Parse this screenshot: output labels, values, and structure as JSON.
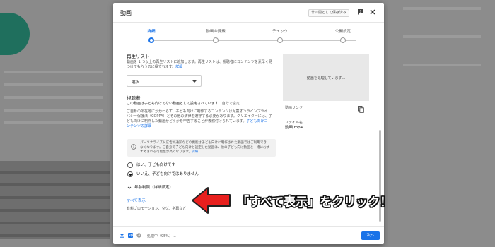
{
  "dialog": {
    "title": "動画",
    "save_private_label": "非公開として保存済み"
  },
  "stepper": {
    "steps": [
      {
        "label": "詳細",
        "active": true
      },
      {
        "label": "動画の要素",
        "active": false
      },
      {
        "label": "チェック",
        "active": false
      },
      {
        "label": "公開設定",
        "active": false
      }
    ]
  },
  "playlist": {
    "heading": "再生リスト",
    "description_line1": "動画を 1 つ以上の再生リストに追加します。再生リストは、視聴者にコンテンツを素早く見",
    "description_line2": "つけてもらうのに役立ちます。",
    "details_link": "詳細",
    "select_value": "選択"
  },
  "audience": {
    "heading": "視聴者",
    "status": "この動画は子ども向けでない動画として設定されています",
    "status_suffix": "自分で設定",
    "body_line1": "ご自身の所在地にかかわらず、子ども向けに制作するコンテンツは児童オンラインプライ",
    "body_line2": "バシー保護法（COPPA）とその他の法律を遵守する必要があります。クリエイターには、子",
    "body_line3": "ども向けに制作した動画かどうかを申告することが義務付けられています。",
    "body_link_a": "子ども向けコ",
    "body_link_b": "ンテンツの詳細",
    "info_line1": "パーソナライズド広告や通知などの機能は子ども向けに制作された動画ではご利用でき",
    "info_line2": "なくなります。ご自身で子ども向けと設定した動画は、他の子ども向け動画と一緒におす",
    "info_line3": "すめされる可能性が高くなります。",
    "info_link": "詳細",
    "option_yes": "はい、子ども向けです",
    "option_no": "いいえ、子ども向けではありません",
    "age_restriction": "年齢制限（詳細設定）"
  },
  "more": {
    "show_all": "すべて表示",
    "subtitle": "有料プロモーション、タグ、字幕など"
  },
  "preview": {
    "processing": "動画を処理しています...",
    "link_label": "動画リンク",
    "filename_label": "ファイル名",
    "filename": "動画.mp4"
  },
  "footer": {
    "status": "処理中（95%）...",
    "next_label": "次へ"
  },
  "annotation": {
    "text": "「すべて表示」をクリック！"
  },
  "colors": {
    "accent": "#1a73e8",
    "annotation_arrow": "#e8201e"
  }
}
